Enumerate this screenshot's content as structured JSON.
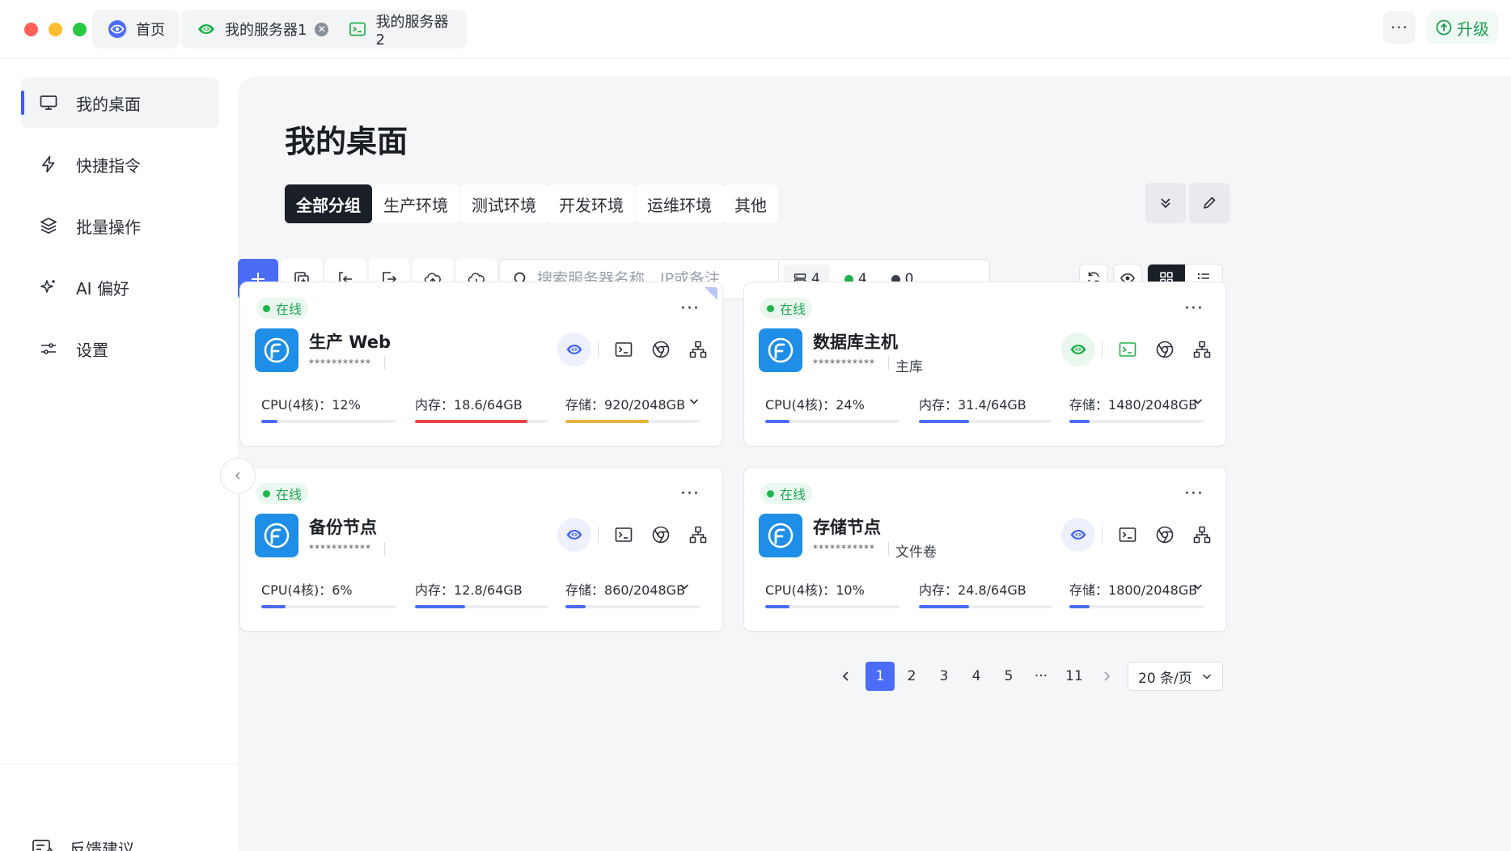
{
  "window": {
    "tabs": [
      {
        "label": "首页",
        "icon": "eye-logo-icon"
      },
      {
        "label": "我的服务器1",
        "icon": "eye-logo-icon",
        "closable": true
      },
      {
        "label": "我的服务器2",
        "icon": "terminal-icon"
      }
    ],
    "more_label": "···",
    "upgrade_label": "升级"
  },
  "sidebar": {
    "items": [
      {
        "label": "我的桌面",
        "icon": "monitor-icon",
        "active": true
      },
      {
        "label": "快捷指令",
        "icon": "lightning-icon"
      },
      {
        "label": "批量操作",
        "icon": "layers-icon"
      },
      {
        "label": "AI 偏好",
        "icon": "sparkle-icon"
      },
      {
        "label": "设置",
        "icon": "sliders-icon"
      }
    ],
    "feedback_label": "反馈建议"
  },
  "main": {
    "title": "我的桌面",
    "filters": [
      "全部分组",
      "生产环境",
      "测试环境",
      "开发环境",
      "运维环境",
      "其他"
    ],
    "active_filter": "全部分组",
    "search_placeholder": "搜索服务器名称、IP或备注",
    "stats": {
      "total": "4",
      "online": "4",
      "offline": "0"
    }
  },
  "servers": [
    {
      "status": "在线",
      "name": "生产 Web",
      "ip": "***********",
      "note": "",
      "cpu_label": "CPU(4核)：",
      "cpu": "12%",
      "cpu_pct": 12,
      "mem_label": "内存：",
      "mem": "18.6/64GB",
      "mem_pct": 85,
      "disk_label": "存储：",
      "disk": "920/2048GB",
      "disk_pct": 62,
      "mem_color": "#e84545",
      "disk_color": "#e8b43a"
    },
    {
      "status": "在线",
      "name": "数据库主机",
      "ip": "***********",
      "note": "主库",
      "cpu_label": "CPU(4核)：",
      "cpu": "24%",
      "cpu_pct": 18,
      "mem_label": "内存：",
      "mem": "31.4/64GB",
      "mem_pct": 38,
      "disk_label": "存储：",
      "disk": "1480/2048GB",
      "disk_pct": 15,
      "mem_color": "#4a6cf7",
      "disk_color": "#4a6cf7"
    },
    {
      "status": "在线",
      "name": "备份节点",
      "ip": "***********",
      "note": "",
      "cpu_label": "CPU(4核)：",
      "cpu": "6%",
      "cpu_pct": 18,
      "mem_label": "内存：",
      "mem": "12.8/64GB",
      "mem_pct": 38,
      "disk_label": "存储：",
      "disk": "860/2048GB",
      "disk_pct": 15,
      "mem_color": "#4a6cf7",
      "disk_color": "#4a6cf7"
    },
    {
      "status": "在线",
      "name": "存储节点",
      "ip": "***********",
      "note": "文件卷",
      "cpu_label": "CPU(4核)：",
      "cpu": "10%",
      "cpu_pct": 18,
      "mem_label": "内存：",
      "mem": "24.8/64GB",
      "mem_pct": 38,
      "disk_label": "存储：",
      "disk": "1800/2048GB",
      "disk_pct": 15,
      "mem_color": "#4a6cf7",
      "disk_color": "#4a6cf7"
    }
  ],
  "pagination": {
    "pages": [
      "1",
      "2",
      "3",
      "4",
      "5",
      "···",
      "11"
    ],
    "current": "1",
    "page_size": "20 条/页"
  },
  "colors": {
    "accent": "#4a6cf7",
    "online": "#21b34f",
    "upgrade": "#1e9e53"
  }
}
